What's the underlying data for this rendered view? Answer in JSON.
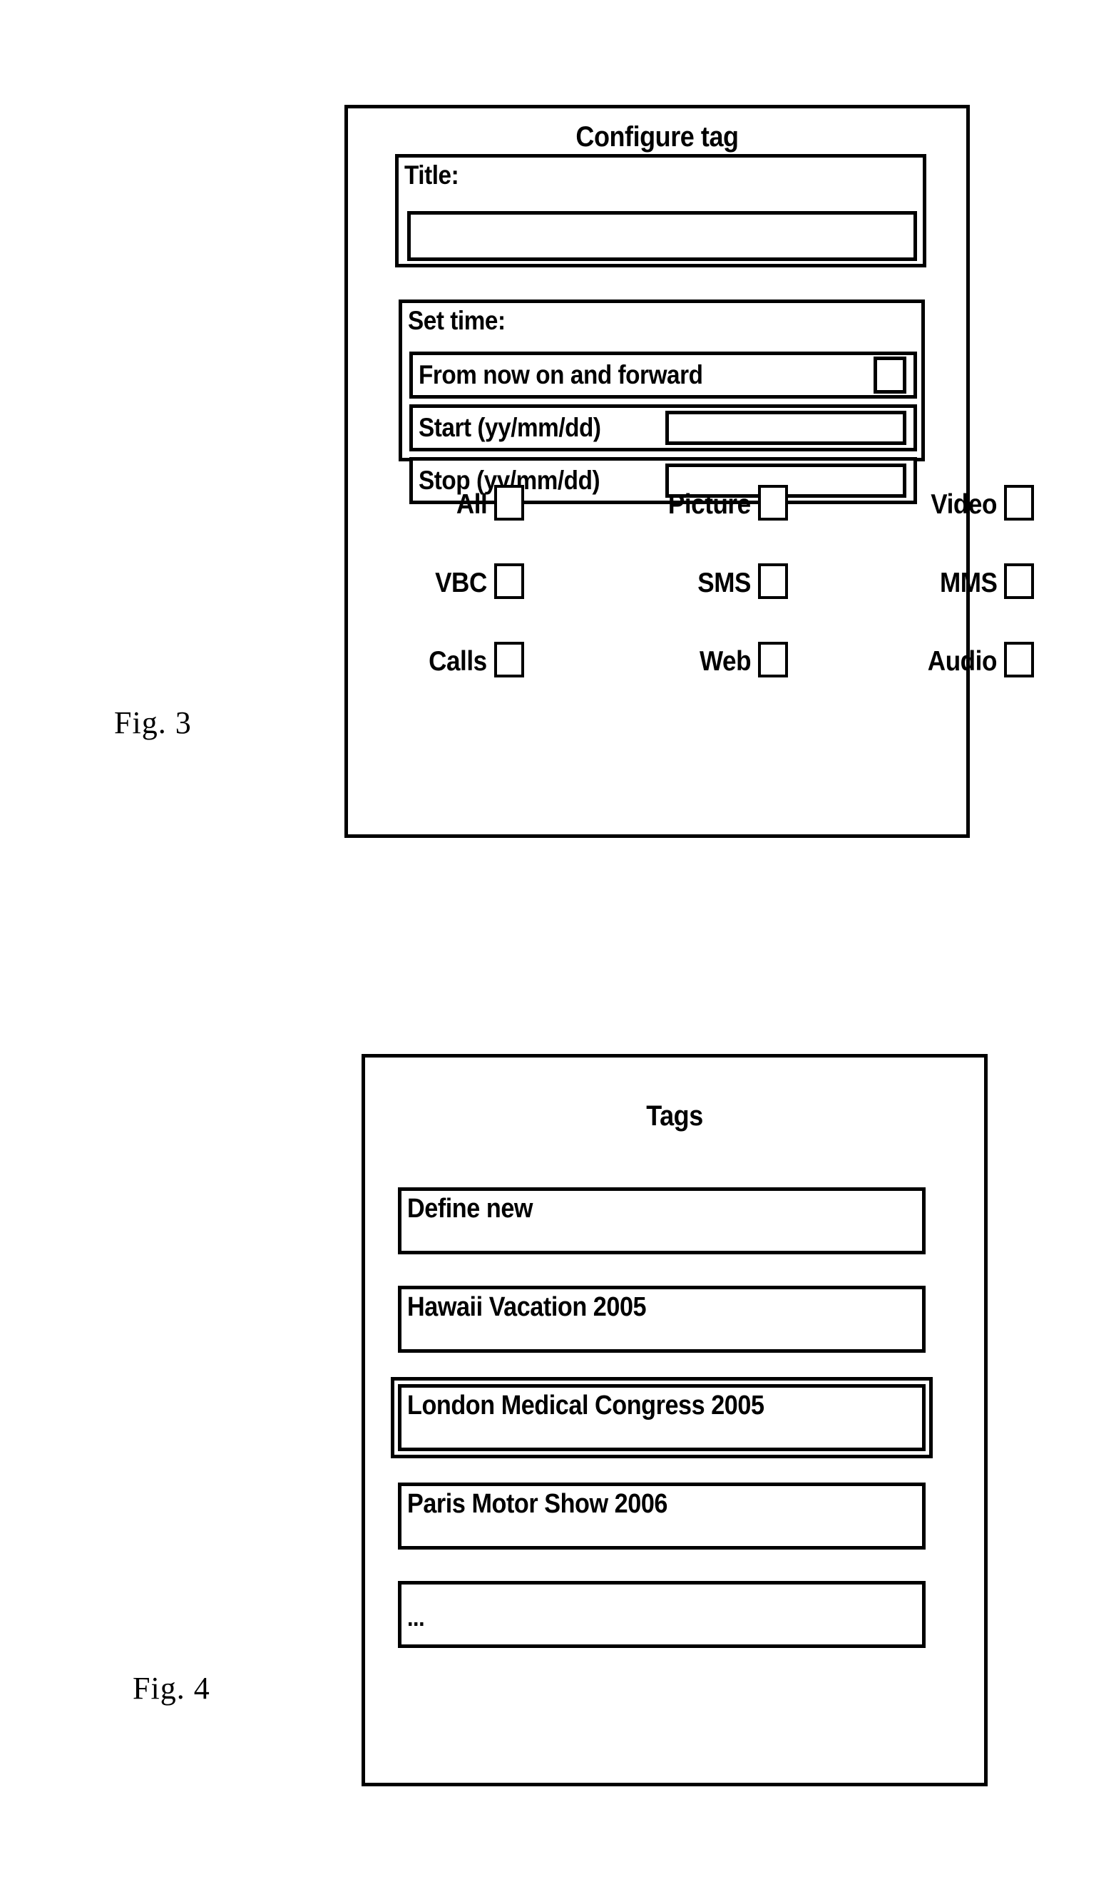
{
  "figures": [
    {
      "caption": "Fig. 3",
      "dialog": {
        "title": "Configure tag",
        "title_group": {
          "label": "Title:",
          "input_value": "",
          "input_placeholder": ""
        },
        "set_time_group": {
          "label": "Set time:",
          "rows": [
            {
              "label": "From now on and forward",
              "control": "checkbox",
              "checked": false
            },
            {
              "label": "Start (yy/mm/dd)",
              "control": "textfield",
              "value": ""
            },
            {
              "label": "Stop (yy/mm/dd)",
              "control": "textfield",
              "value": ""
            }
          ]
        },
        "checkbox_grid": [
          [
            {
              "label": "All",
              "checked": false
            },
            {
              "label": "Picture",
              "checked": false
            },
            {
              "label": "Video",
              "checked": false
            }
          ],
          [
            {
              "label": "VBC",
              "checked": false
            },
            {
              "label": "SMS",
              "checked": false
            },
            {
              "label": "MMS",
              "checked": false
            }
          ],
          [
            {
              "label": "Calls",
              "checked": false
            },
            {
              "label": "Web",
              "checked": false
            },
            {
              "label": "Audio",
              "checked": false
            }
          ]
        ]
      }
    },
    {
      "caption": "Fig. 4",
      "dialog": {
        "title": "Tags",
        "items": [
          {
            "label": "Define new",
            "selected": false
          },
          {
            "label": "Hawaii Vacation 2005",
            "selected": false
          },
          {
            "label": "London Medical Congress 2005",
            "selected": true
          },
          {
            "label": "Paris Motor Show 2006",
            "selected": false
          },
          {
            "label": "...",
            "selected": false
          }
        ]
      }
    }
  ],
  "colors": {
    "ink": "#000000",
    "paper": "#ffffff"
  }
}
